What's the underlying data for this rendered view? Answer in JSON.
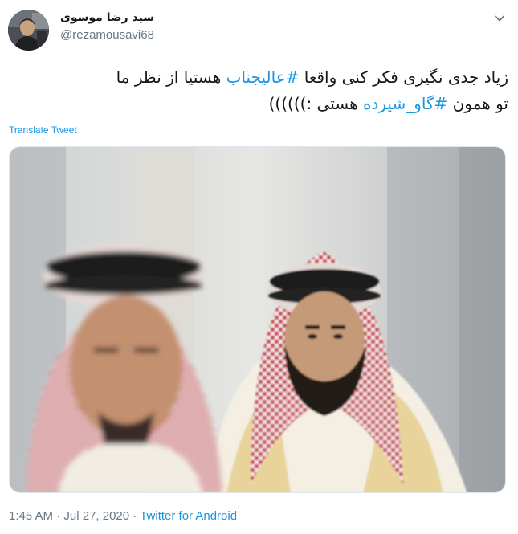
{
  "author": {
    "display_name": "سید رضا موسوی",
    "handle": "@rezamousavi68",
    "avatar": "profile-photo"
  },
  "menu": {
    "icon": "chevron-down-icon"
  },
  "tweet": {
    "line1_before": "زیاد جدی نگیری فکر کنی واقعا ",
    "hashtag1": "#عالیجناب",
    "line1_after": " هستیا  از نظر ما",
    "line2_before": "تو همون ",
    "hashtag2": "#گاو_شیرده",
    "line2_after": " هستی :))))))"
  },
  "translate_label": "Translate Tweet",
  "media": {
    "kind": "photo"
  },
  "meta": {
    "time": "1:45 AM",
    "separator": " · ",
    "date": "Jul 27, 2020",
    "separator2": " · ",
    "source": "Twitter for Android"
  },
  "colors": {
    "link": "#1b95e0",
    "secondary": "#657786",
    "text": "#14171a"
  }
}
